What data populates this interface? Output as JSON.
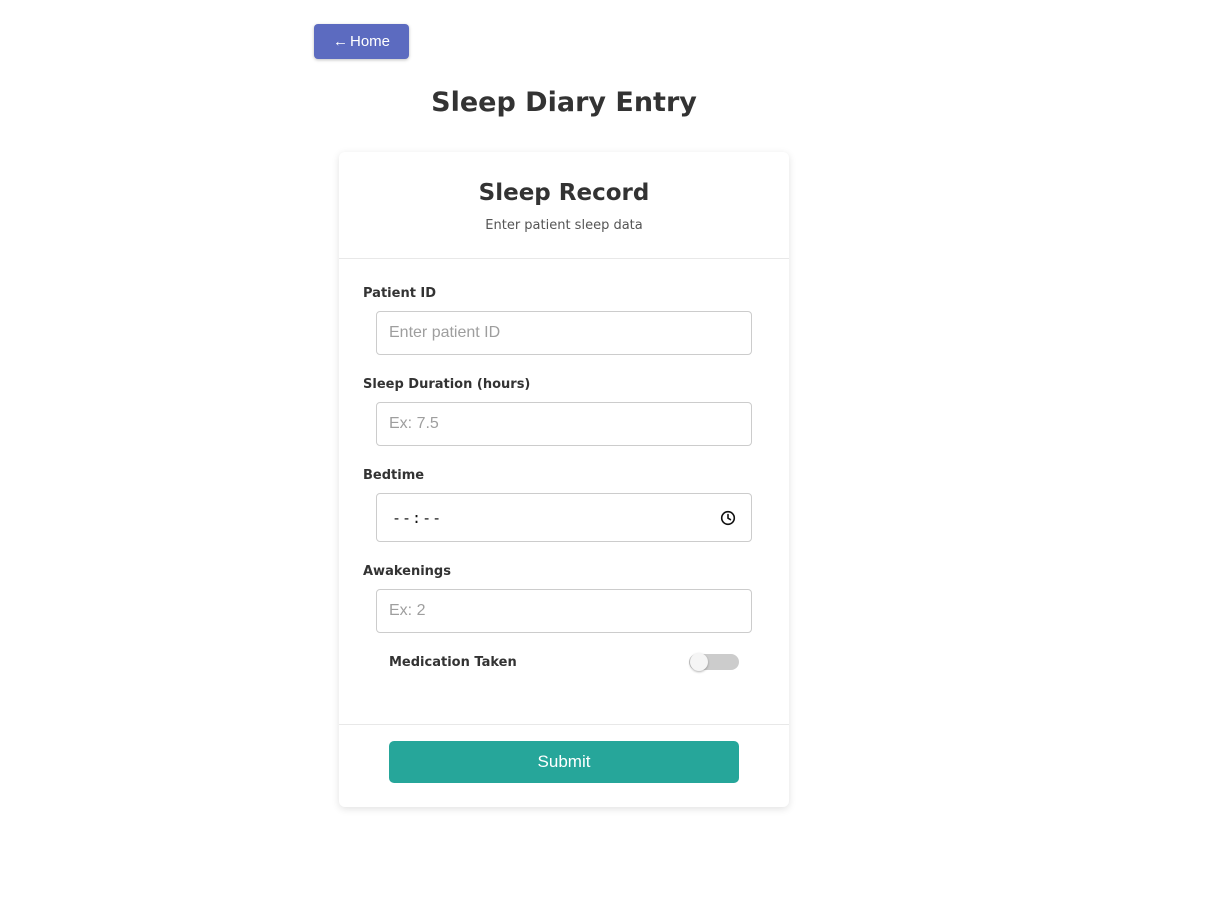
{
  "nav": {
    "home_arrow": "←",
    "home_label": "Home"
  },
  "page": {
    "title": "Sleep Diary Entry"
  },
  "card": {
    "title": "Sleep Record",
    "subtitle": "Enter patient sleep data"
  },
  "form": {
    "patient_id": {
      "label": "Patient ID",
      "placeholder": "Enter patient ID",
      "value": ""
    },
    "sleep_duration": {
      "label": "Sleep Duration (hours)",
      "placeholder": "Ex: 7.5",
      "value": ""
    },
    "bedtime": {
      "label": "Bedtime",
      "display_value": "--:--",
      "icon": "clock-icon"
    },
    "awakenings": {
      "label": "Awakenings",
      "placeholder": "Ex: 2",
      "value": ""
    },
    "medication": {
      "label": "Medication Taken",
      "checked": false
    },
    "submit_label": "Submit"
  },
  "colors": {
    "home_button": "#5c6bc0",
    "submit_button": "#26a69a",
    "toggle_off": "#cccccc"
  }
}
